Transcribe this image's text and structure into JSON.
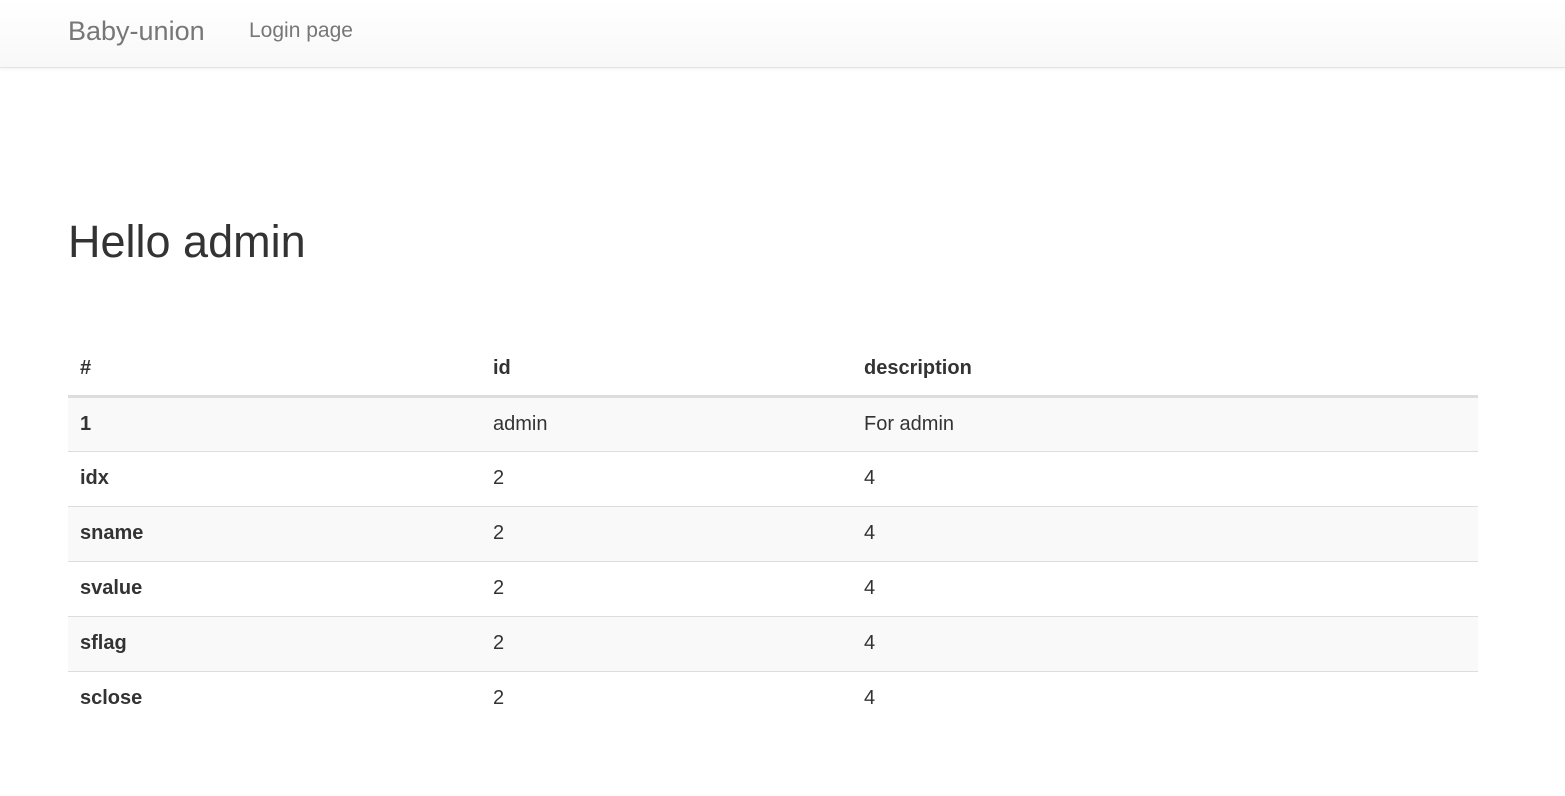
{
  "navbar": {
    "brand": "Baby-union",
    "links": [
      {
        "label": "Login page"
      }
    ]
  },
  "main": {
    "title": "Hello admin",
    "table": {
      "headers": [
        "#",
        "id",
        "description"
      ],
      "rows": [
        [
          "1",
          "admin",
          "For admin"
        ],
        [
          "idx",
          "2",
          "4"
        ],
        [
          "sname",
          "2",
          "4"
        ],
        [
          "svalue",
          "2",
          "4"
        ],
        [
          "sflag",
          "2",
          "4"
        ],
        [
          "sclose",
          "2",
          "4"
        ]
      ]
    }
  }
}
